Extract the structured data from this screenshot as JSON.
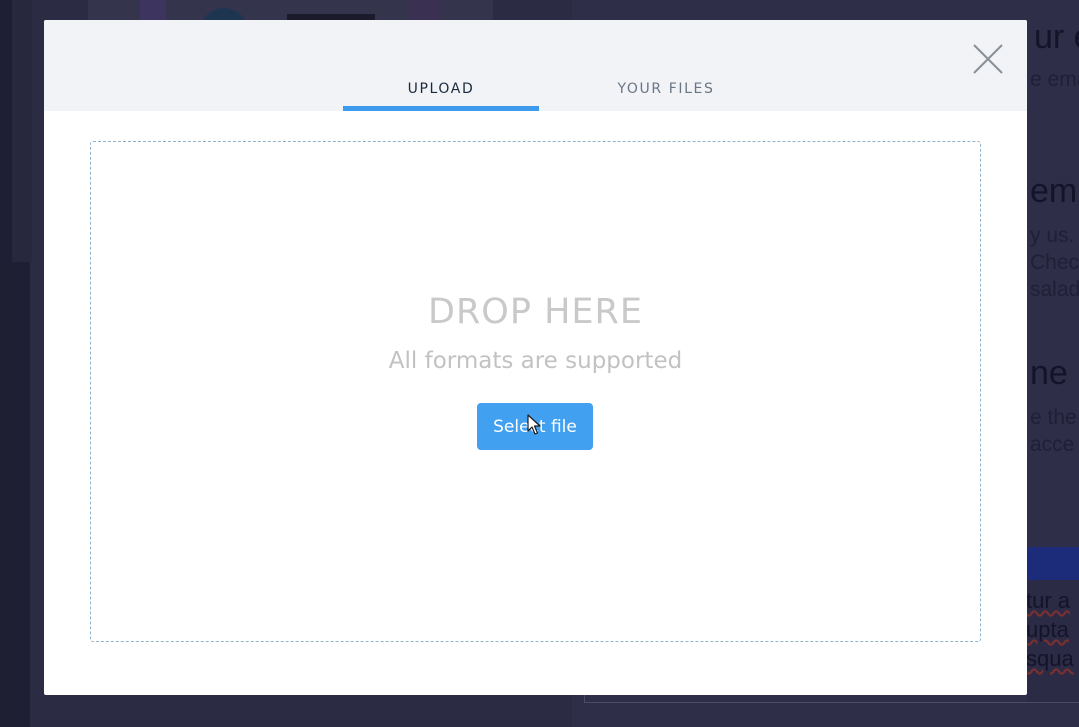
{
  "background": {
    "heading_1": "ur e",
    "sub_1": "e ema",
    "heading_2": "em",
    "sub_2": "y us.",
    "sub_3": "Chec",
    "sub_4": "salad",
    "heading_3": "ne l",
    "sub_5": "e the",
    "sub_6": "acce",
    "textarea_line_1": "tur a",
    "textarea_line_2": "upta",
    "textarea_line_3": "squa"
  },
  "modal": {
    "tabs": [
      {
        "label": "UPLOAD",
        "active": true
      },
      {
        "label": "YOUR FILES",
        "active": false
      }
    ],
    "close_icon": "close-icon",
    "dropzone": {
      "title": "DROP HERE",
      "subtitle": "All formats are supported",
      "button_label": "Select file"
    }
  },
  "colors": {
    "accent": "#42a0f0",
    "tab_underline": "#3d9aed",
    "header_bg": "#f1f3f7",
    "overlay": "#2b2b43"
  }
}
